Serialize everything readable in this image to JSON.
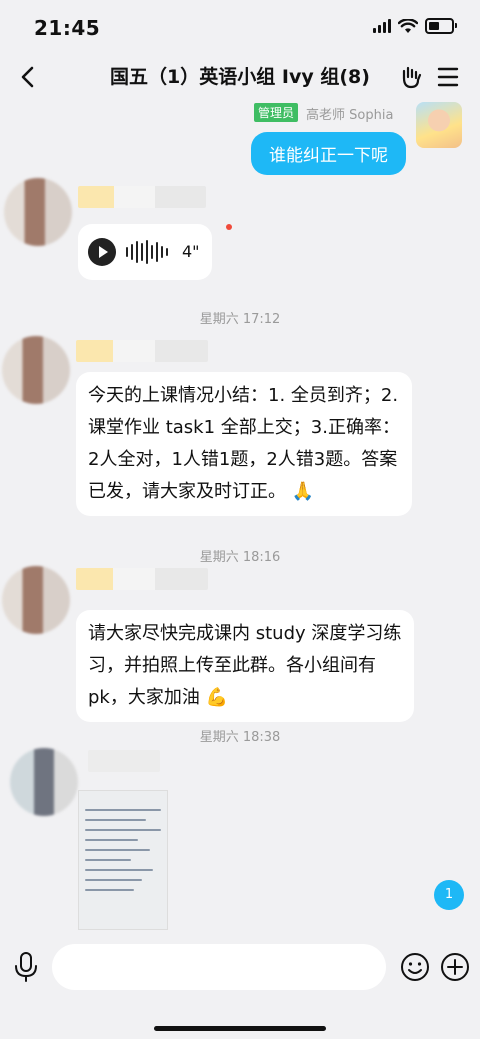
{
  "status_bar": {
    "time": "21:45"
  },
  "header": {
    "title": "国五（1）英语小组 Ivy 组(8)"
  },
  "messages": {
    "self_role_badge": "管理员",
    "self_sender": "高老师 Sophia",
    "self_text": "谁能纠正一下呢",
    "voice_duration": "4\"",
    "ts1": "星期六 17:12",
    "msg1": "今天的上课情况小结：1. 全员到齐；2.课堂作业 task1 全部上交；3.正确率：2人全对，1人错1题，2人错3题。答案已发，请大家及时订正。",
    "msg1_emoji": "🙏",
    "ts2": "星期六 18:16",
    "msg2": "请大家尽快完成课内 study 深度学习练习，并拍照上传至此群。各小组间有 pk，大家加油",
    "msg2_emoji": "💪",
    "ts3": "星期六 18:38",
    "unread_count": "1"
  },
  "input": {
    "placeholder": ""
  },
  "icons": [
    "signal-icon",
    "wifi-icon",
    "battery-icon",
    "back-icon",
    "hand-gesture-icon",
    "menu-icon",
    "play-icon",
    "mic-icon",
    "emoji-icon",
    "plus-icon"
  ],
  "colors": {
    "accent_blue": "#1eb8f6",
    "admin_green": "#3fbd63",
    "unread_red": "#f04a3a"
  }
}
